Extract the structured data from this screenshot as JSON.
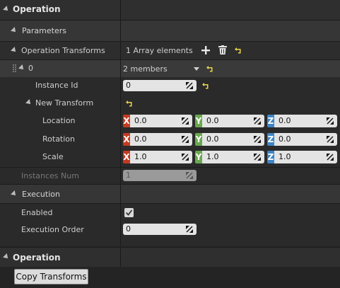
{
  "section_operation": {
    "title": "Operation"
  },
  "parameters": {
    "label": "Parameters"
  },
  "operation_transforms": {
    "label": "Operation Transforms",
    "count_text": "1 Array elements"
  },
  "element0": {
    "index": "0",
    "members_text": "2 members"
  },
  "instance_id": {
    "label": "Instance Id",
    "value": "0"
  },
  "new_transform": {
    "label": "New Transform"
  },
  "location": {
    "label": "Location",
    "x": "0.0",
    "y": "0.0",
    "z": "0.0"
  },
  "rotation": {
    "label": "Rotation",
    "x": "0.0",
    "y": "0.0",
    "z": "0.0"
  },
  "scale": {
    "label": "Scale",
    "x": "1.0",
    "y": "1.0",
    "z": "1.0"
  },
  "axes": {
    "x": "X",
    "y": "Y",
    "z": "Z",
    "x_color": "#c23b22",
    "y_color": "#6aa84f",
    "z_color": "#3d85c6"
  },
  "instances_num": {
    "label": "Instances Num",
    "value": "1"
  },
  "execution": {
    "title": "Execution"
  },
  "enabled": {
    "label": "Enabled",
    "checked": true
  },
  "execution_order": {
    "label": "Execution Order",
    "value": "0"
  },
  "section_operation2": {
    "title": "Operation"
  },
  "copy_transforms": {
    "label": "Copy Transforms"
  },
  "icons": [
    "plus-icon",
    "trash-icon",
    "reset-arrow-icon",
    "drag-handle-icon",
    "checkmark-icon",
    "dropdown-arrow-icon",
    "expand-triangle-icon"
  ],
  "colors": {
    "background": "#242424",
    "header_bg": "#2f2f2f",
    "row_alt": "#2a2a2a",
    "field_bg": "#e4e4e4",
    "reset_yellow": "#e8d44d"
  }
}
